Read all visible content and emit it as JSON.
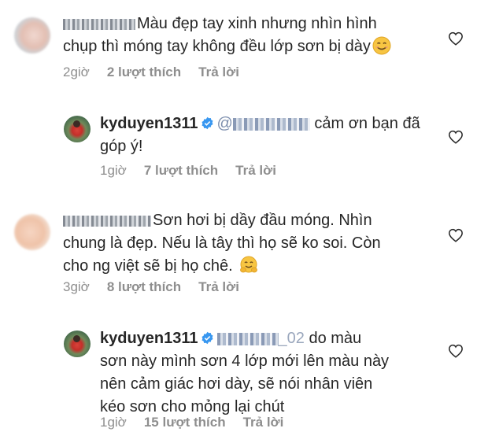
{
  "comments": [
    {
      "username_redacted": "l...7023",
      "text_line1": "Màu đẹp tay xinh nhưng nhìn hình",
      "text_line2": "chụp thì móng tay không đều lớp sơn bị dày",
      "time": "2giờ",
      "likes": "2 lượt thích",
      "reply": "Trả lời"
    },
    {
      "username": "kyduyen1311",
      "text_line1": "cảm ơn bạn đã",
      "text_line2": "góp ý!",
      "time": "1giờ",
      "likes": "7 lượt thích",
      "reply": "Trả lời"
    },
    {
      "text_line1": "Sơn hơi bị dầy đầu móng. Nhìn",
      "text_line2": "chung là đẹp. Nếu là tây thì họ sẽ ko soi. Còn",
      "text_line3": "cho ng việt sẽ bị họ chê.",
      "time": "3giờ",
      "likes": "8 lượt thích",
      "reply": "Trả lời"
    },
    {
      "username": "kyduyen1311",
      "mention_tail": "_02",
      "text_line1": "do màu",
      "text_line2": "sơn này mình sơn 4 lớp mới lên màu này",
      "text_line3": "nên cảm giác hơi dày,  sẽ nói nhân viên",
      "text_line4": "kéo sơn cho mỏng lại chút",
      "time": "1giờ",
      "likes": "15 lượt thích",
      "reply": "Trả lời"
    }
  ],
  "icons": {
    "like": "heart-outline-icon",
    "verified": "verified-badge-icon",
    "emoji_smile": "smiling-face-emoji",
    "emoji_hug": "hugging-face-emoji"
  },
  "colors": {
    "text": "#262626",
    "meta": "#8e8e8e",
    "verified": "#3897f0"
  }
}
